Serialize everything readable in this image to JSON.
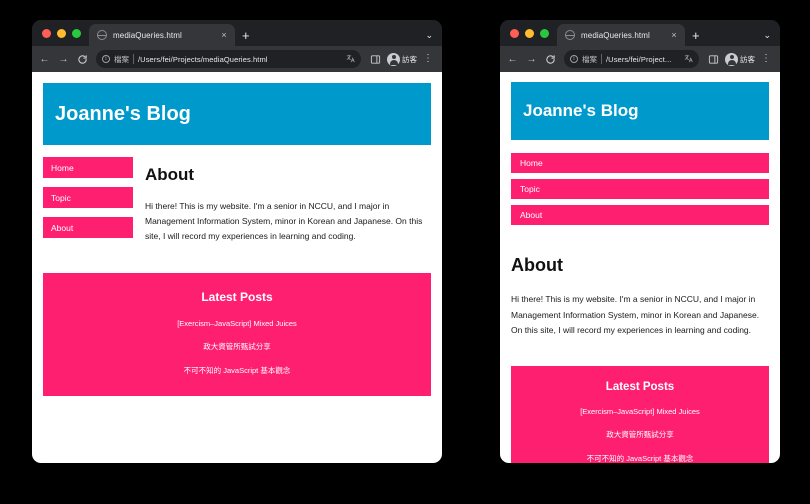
{
  "browser": {
    "traffic_lights": [
      "close",
      "minimize",
      "maximize"
    ],
    "tab": {
      "title": "mediaQueries.html",
      "favicon": "globe-icon",
      "close": "×"
    },
    "new_tab_label": "+",
    "tab_list_chevron": "⌄",
    "toolbar": {
      "back": "←",
      "forward": "→",
      "reload": "C",
      "info": "ⓘ",
      "scheme_label": "檔案",
      "url_full": "/Users/fei/Projects/mediaQueries.html",
      "url_truncated": "/Users/fei/Project...",
      "translate_icon": "translate-icon",
      "side_panel_icon": "side-panel-icon",
      "profile_label": "訪客",
      "menu": "⋮"
    }
  },
  "page": {
    "header_title": "Joanne's Blog",
    "nav": [
      {
        "label": "Home"
      },
      {
        "label": "Topic"
      },
      {
        "label": "About"
      }
    ],
    "about": {
      "title": "About",
      "body": "Hi there! This is my website. I'm a senior in NCCU, and I major in Management Information System, minor in Korean and Japanese. On this site, I will record my experiences in learning and coding."
    },
    "latest_posts": {
      "title": "Latest Posts",
      "items": [
        {
          "label": "[Exercism–JavaScript] Mixed Juices"
        },
        {
          "label": "政大資管所甄試分享"
        },
        {
          "label": "不可不知的 JavaScript 基本觀念"
        }
      ]
    }
  },
  "colors": {
    "header_blue": "#0099cc",
    "accent_pink": "#ff1f71",
    "chrome_dark": "#202124",
    "toolbar_dark": "#35363a",
    "page_white": "#ffffff",
    "backdrop": "#000000"
  }
}
